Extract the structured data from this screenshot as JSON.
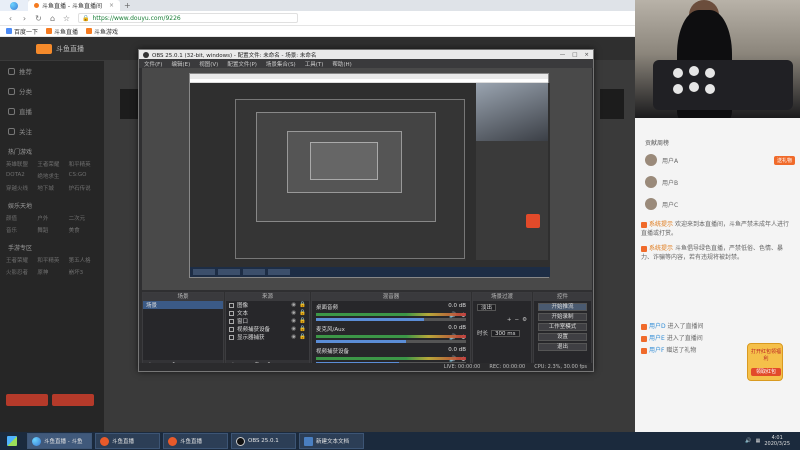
{
  "browser": {
    "brand": "",
    "tabs": [
      {
        "label": "斗鱼直播 - 斗鱼直播间",
        "active": true
      },
      {
        "label": "斗鱼直播",
        "active": false
      }
    ],
    "new_tab": "+",
    "url": "https://www.douyu.com/9226",
    "bookmarks": [
      "百度一下",
      "斗鱼直播",
      "斗鱼游戏"
    ]
  },
  "site": {
    "logo_text": "斗鱼直播",
    "sidebar": {
      "items": [
        "推荐",
        "分类",
        "直播",
        "关注"
      ],
      "sections": [
        {
          "title": "热门游戏",
          "cells": [
            "英雄联盟",
            "王者荣耀",
            "和平精英",
            "DOTA2",
            "绝地求生",
            "CS:GO",
            "穿越火线",
            "地下城",
            "炉石传说"
          ]
        },
        {
          "title": "娱乐天地",
          "cells": [
            "颜值",
            "户外",
            "二次元",
            "音乐",
            "舞蹈",
            "美食"
          ]
        },
        {
          "title": "手游专区",
          "cells": [
            "王者荣耀",
            "和平精英",
            "第五人格",
            "火影忍者",
            "原神",
            "崩坏3"
          ]
        }
      ]
    }
  },
  "obs": {
    "title": "OBS 25.0.1 (32-bit, windows) - 配置文件: 未命名 - 场景: 未命名",
    "menu": [
      "文件(F)",
      "编辑(E)",
      "视图(V)",
      "配置文件(P)",
      "场景集合(S)",
      "工具(T)",
      "帮助(H)"
    ],
    "docks": {
      "scenes": {
        "header": "场景",
        "items": [
          "场景"
        ]
      },
      "sources": {
        "header": "来源",
        "items": [
          "图像",
          "文本",
          "窗口",
          "视频捕获设备",
          "显示器捕获"
        ]
      },
      "mixer": {
        "header": "混音器",
        "channels": [
          {
            "name": "桌面音频",
            "db": "0.0 dB",
            "level": 0.72
          },
          {
            "name": "麦克风/Aux",
            "db": "0.0 dB",
            "level": 0.6
          },
          {
            "name": "视频捕获设备",
            "db": "0.0 dB",
            "level": 0.55
          }
        ]
      },
      "transitions": {
        "header": "场景过渡",
        "type": "淡出",
        "duration_label": "时长",
        "duration": "300 ms"
      },
      "controls": {
        "header": "控件",
        "buttons": [
          "开始推流",
          "开始录制",
          "工作室模式",
          "设置",
          "退出"
        ]
      }
    },
    "status": {
      "live": "LIVE: 00:00:00",
      "rec": "REC: 00:00:00",
      "cpu": "CPU: 2.3%, 30.00 fps"
    }
  },
  "chat": {
    "rank_header": "贡献周榜",
    "ranks": [
      {
        "name": "用户A",
        "tag": "送礼物"
      },
      {
        "name": "用户B",
        "tag": ""
      },
      {
        "name": "用户C",
        "tag": ""
      }
    ],
    "messages": [
      {
        "user": "系统提示",
        "text": "欢迎来到本直播间，斗鱼严禁未成年人进行直播或打赏。"
      },
      {
        "user": "系统提示",
        "text": "斗鱼倡导绿色直播，严禁低俗、色情、暴力、诈骗等内容，若有违规将被封禁。"
      },
      {
        "user": "用户D",
        "text": "进入了直播间"
      },
      {
        "user": "用户E",
        "text": "进入了直播间"
      },
      {
        "user": "用户F",
        "text": "赠送了礼物"
      }
    ],
    "redbag": {
      "title": "打开红包领福利",
      "button": "领取红包"
    }
  },
  "taskbar": {
    "buttons": [
      {
        "label": "斗鱼直播 - 斗鱼",
        "icon": "browser"
      },
      {
        "label": "斗鱼直播",
        "icon": "douyu"
      },
      {
        "label": "斗鱼直播",
        "icon": "douyu"
      },
      {
        "label": "OBS 25.0.1",
        "icon": "obs"
      },
      {
        "label": "新建文本文档",
        "icon": "doc"
      }
    ],
    "time": "4:01",
    "date": "2020/3/25"
  }
}
